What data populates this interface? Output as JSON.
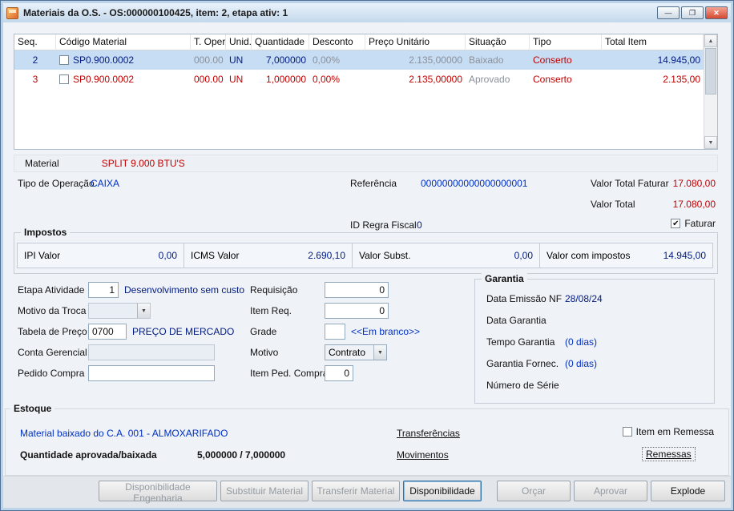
{
  "window": {
    "title": "Materiais da O.S. - OS:000000100425, item: 2, etapa ativ: 1"
  },
  "icons": {
    "minimize": "—",
    "maximize": "❐",
    "close": "✕",
    "combo_arrow": "▼",
    "scroll_up": "▲",
    "scroll_down": "▼",
    "check": "✔"
  },
  "grid": {
    "columns": [
      "Seq.",
      "Código Material",
      "T. Oper",
      "Unid.",
      "Quantidade",
      "Desconto",
      "Preço Unitário",
      "Situação",
      "Tipo",
      "Total Item"
    ],
    "rows": [
      {
        "seq": "2",
        "codigo": "SP0.900.0002",
        "t_oper": "000.00",
        "unid": "UN",
        "quantidade": "7,000000",
        "desconto": "0,00%",
        "preco_unitario": "2.135,00000",
        "situacao": "Baixado",
        "tipo": "Conserto",
        "total_item": "14.945,00",
        "selected": true,
        "checked": false
      },
      {
        "seq": "3",
        "codigo": "SP0.900.0002",
        "t_oper": "000.00",
        "unid": "UN",
        "quantidade": "1,000000",
        "desconto": "0,00%",
        "preco_unitario": "2.135,00000",
        "situacao": "Aprovado",
        "tipo": "Conserto",
        "total_item": "2.135,00",
        "selected": false,
        "checked": false
      }
    ]
  },
  "details": {
    "material_label": "Material",
    "material_value": "SPLIT 9.000 BTU'S",
    "tipo_operacao_label": "Tipo de Operação",
    "tipo_operacao_value": "CAIXA",
    "referencia_label": "Referência",
    "referencia_value": "00000000000000000001",
    "valor_total_faturar_label": "Valor Total Faturar",
    "valor_total_faturar_value": "17.080,00",
    "valor_total_label": "Valor Total",
    "valor_total_value": "17.080,00",
    "id_regra_fiscal_label": "ID Regra Fiscal",
    "id_regra_fiscal_value": "0",
    "faturar_label": "Faturar",
    "faturar_checked": true
  },
  "impostos": {
    "title": "Impostos",
    "ipi_label": "IPI Valor",
    "ipi_value": "0,00",
    "icms_label": "ICMS Valor",
    "icms_value": "2.690,10",
    "subst_label": "Valor Subst.",
    "subst_value": "0,00",
    "com_impostos_label": "Valor com impostos",
    "com_impostos_value": "14.945,00"
  },
  "form": {
    "etapa_atividade_label": "Etapa Atividade",
    "etapa_atividade_value": "1",
    "etapa_atividade_desc": "Desenvolvimento sem custo",
    "motivo_troca_label": "Motivo da Troca",
    "tabela_preco_label": "Tabela de Preço",
    "tabela_preco_value": "0700",
    "tabela_preco_desc": "PREÇO DE MERCADO",
    "conta_gerencial_label": "Conta Gerencial",
    "pedido_compra_label": "Pedido Compra",
    "requisicao_label": "Requisição",
    "requisicao_value": "0",
    "item_req_label": "Item Req.",
    "item_req_value": "0",
    "grade_label": "Grade",
    "grade_desc": "<<Em branco>>",
    "motivo_label": "Motivo",
    "motivo_value": "Contrato",
    "item_ped_compra_label": "Item Ped. Compra",
    "item_ped_compra_value": "0"
  },
  "garantia": {
    "title": "Garantia",
    "data_emissao_label": "Data Emissão NF",
    "data_emissao_value": "28/08/24",
    "data_garantia_label": "Data Garantia",
    "tempo_garantia_label": "Tempo Garantia",
    "tempo_garantia_value": "(0 dias)",
    "garantia_fornec_label": "Garantia Fornec.",
    "garantia_fornec_value": "(0 dias)",
    "numero_serie_label": "Número de Série"
  },
  "estoque": {
    "title": "Estoque",
    "material_baixado": "Material baixado do C.A. 001  - ALMOXARIFADO",
    "transferencias_link": "Transferências",
    "movimentos_link": "Movimentos",
    "item_remessa_label": "Item em Remessa",
    "item_remessa_checked": false,
    "remessas_link": "Remessas",
    "quantidade_label": "Quantidade aprovada/baixada",
    "quantidade_value": "5,000000  /  7,000000"
  },
  "buttons": {
    "disponibilidade_engenharia": "Disponibilidade Engenharia",
    "substituir_material": "Substituir Material",
    "transferir_material": "Transferir Material",
    "disponibilidade": "Disponibilidade",
    "orcar": "Orçar",
    "aprovar": "Aprovar",
    "explode": "Explode"
  }
}
